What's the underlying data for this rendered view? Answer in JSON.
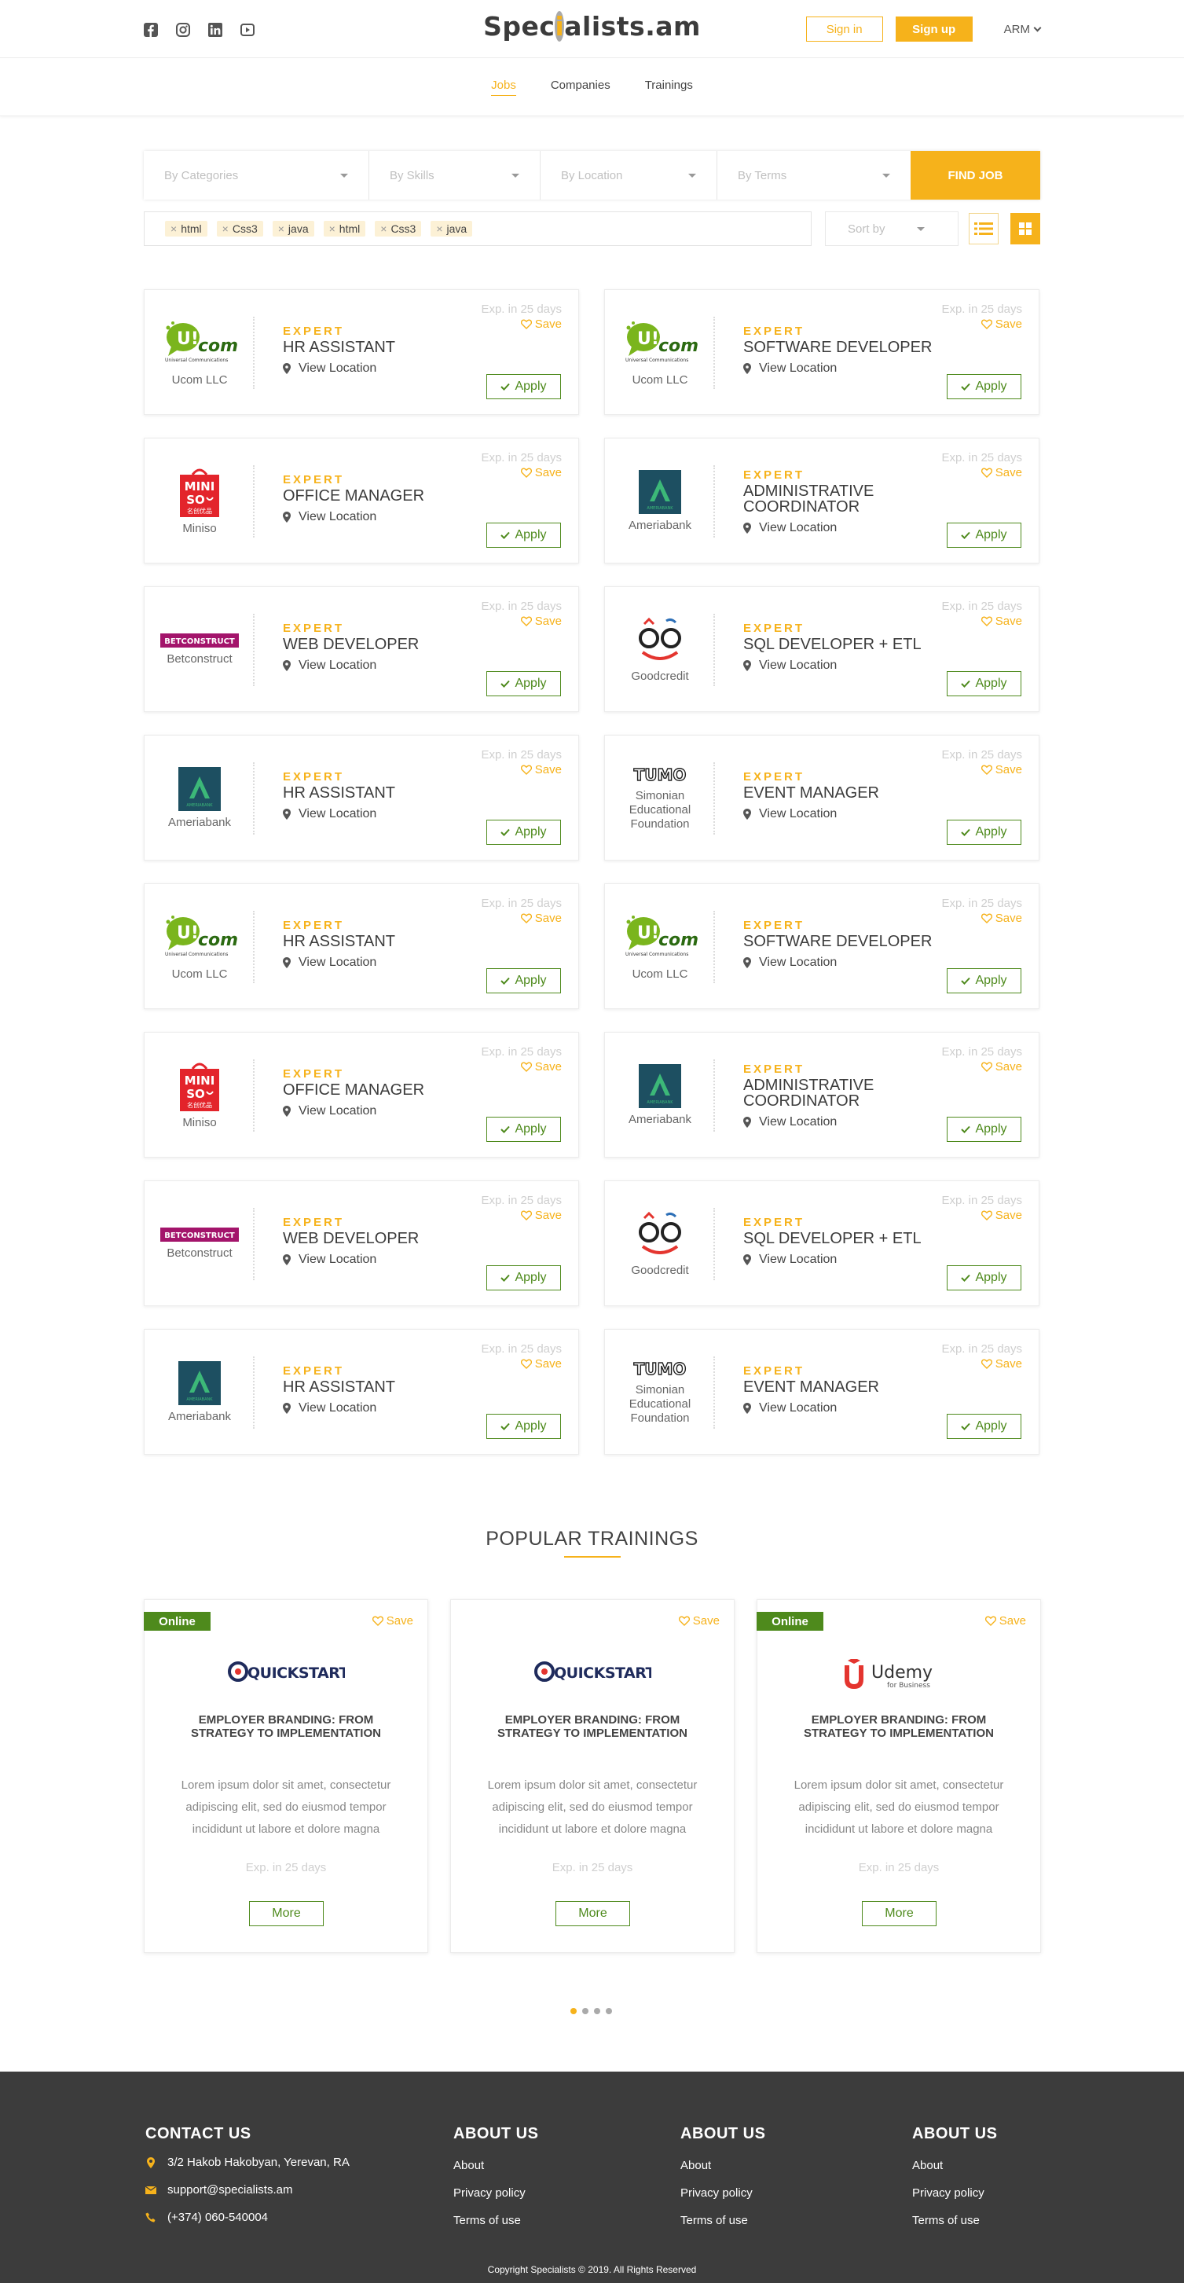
{
  "header": {
    "logo": "Specìalists.am",
    "logo_parts": {
      "before": "Spec",
      "dot": "i",
      "after": "alists.am"
    },
    "sign_in": "Sign in",
    "sign_up": "Sign up",
    "language": "ARM",
    "socials": [
      "facebook-icon",
      "instagram-icon",
      "linkedin-icon",
      "youtube-icon"
    ]
  },
  "nav": {
    "items": [
      {
        "label": "Jobs",
        "active": true
      },
      {
        "label": "Companies",
        "active": false
      },
      {
        "label": "Trainings",
        "active": false
      }
    ]
  },
  "search": {
    "categories": "By Categories",
    "skills": "By Skills",
    "location": "By Location",
    "terms": "By Terms",
    "find_button": "FIND JOB",
    "tags": [
      "html",
      "Css3",
      "java",
      "html",
      "Css3",
      "java"
    ],
    "sort_by": "Sort by"
  },
  "jobs": [
    {
      "company": "Ucom LLC",
      "logo": "ucom",
      "level": "EXPERT",
      "title": "HR ASSISTANT",
      "location": "View Location",
      "expires": "Exp. in 25 days",
      "save": "Save",
      "apply": "Apply"
    },
    {
      "company": "Ucom LLC",
      "logo": "ucom",
      "level": "EXPERT",
      "title": "SOFTWARE DEVELOPER",
      "location": "View Location",
      "expires": "Exp. in 25 days",
      "save": "Save",
      "apply": "Apply"
    },
    {
      "company": "Miniso",
      "logo": "miniso",
      "level": "EXPERT",
      "title": "OFFICE MANAGER",
      "location": "View Location",
      "expires": "Exp. in 25 days",
      "save": "Save",
      "apply": "Apply"
    },
    {
      "company": "Ameriabank",
      "logo": "ameria",
      "level": "EXPERT",
      "title": "ADMINISTRATIVE COORDINATOR",
      "location": "View Location",
      "expires": "Exp. in 25 days",
      "save": "Save",
      "apply": "Apply"
    },
    {
      "company": "Betconstruct",
      "logo": "betc",
      "level": "EXPERT",
      "title": "WEB DEVELOPER",
      "location": "View Location",
      "expires": "Exp. in 25 days",
      "save": "Save",
      "apply": "Apply"
    },
    {
      "company": "Goodcredit",
      "logo": "goodc",
      "level": "EXPERT",
      "title": "SQL DEVELOPER + ETL",
      "location": "View Location",
      "expires": "Exp. in 25 days",
      "save": "Save",
      "apply": "Apply"
    },
    {
      "company": "Ameriabank",
      "logo": "ameria",
      "level": "EXPERT",
      "title": "HR ASSISTANT",
      "location": "View Location",
      "expires": "Exp. in 25 days",
      "save": "Save",
      "apply": "Apply"
    },
    {
      "company": "Simonian Educational Foundation",
      "logo": "tumo",
      "level": "EXPERT",
      "title": "EVENT MANAGER",
      "location": "View Location",
      "expires": "Exp. in 25 days",
      "save": "Save",
      "apply": "Apply"
    },
    {
      "company": "Ucom LLC",
      "logo": "ucom",
      "level": "EXPERT",
      "title": "HR ASSISTANT",
      "location": "View Location",
      "expires": "Exp. in 25 days",
      "save": "Save",
      "apply": "Apply"
    },
    {
      "company": "Ucom LLC",
      "logo": "ucom",
      "level": "EXPERT",
      "title": "SOFTWARE DEVELOPER",
      "location": "View Location",
      "expires": "Exp. in 25 days",
      "save": "Save",
      "apply": "Apply"
    },
    {
      "company": "Miniso",
      "logo": "miniso",
      "level": "EXPERT",
      "title": "OFFICE MANAGER",
      "location": "View Location",
      "expires": "Exp. in 25 days",
      "save": "Save",
      "apply": "Apply"
    },
    {
      "company": "Ameriabank",
      "logo": "ameria",
      "level": "EXPERT",
      "title": "ADMINISTRATIVE COORDINATOR",
      "location": "View Location",
      "expires": "Exp. in 25 days",
      "save": "Save",
      "apply": "Apply"
    },
    {
      "company": "Betconstruct",
      "logo": "betc",
      "level": "EXPERT",
      "title": "WEB DEVELOPER",
      "location": "View Location",
      "expires": "Exp. in 25 days",
      "save": "Save",
      "apply": "Apply"
    },
    {
      "company": "Goodcredit",
      "logo": "goodc",
      "level": "EXPERT",
      "title": "SQL DEVELOPER + ETL",
      "location": "View Location",
      "expires": "Exp. in 25 days",
      "save": "Save",
      "apply": "Apply"
    },
    {
      "company": "Ameriabank",
      "logo": "ameria",
      "level": "EXPERT",
      "title": "HR ASSISTANT",
      "location": "View Location",
      "expires": "Exp. in 25 days",
      "save": "Save",
      "apply": "Apply"
    },
    {
      "company": "Simonian Educational Foundation",
      "logo": "tumo",
      "level": "EXPERT",
      "title": "EVENT MANAGER",
      "location": "View Location",
      "expires": "Exp. in 25 days",
      "save": "Save",
      "apply": "Apply"
    }
  ],
  "logo_texts": {
    "ucom_main": "U!com",
    "ucom_sub": "Universal Communications",
    "miniso_top": "MINI",
    "miniso_mid": "SO",
    "miniso_cn": "名创优品",
    "ameria_sub": "AMERIABANK",
    "betc": "BETCONSTRUCT",
    "tumo": "TUMO",
    "quickstart": "QUICKSTART",
    "udemy": "Udemy",
    "udemy_sub": "for Business"
  },
  "trainings": {
    "heading": "POPULAR TRAININGS",
    "items": [
      {
        "badge": "Online",
        "logo": "quickstart",
        "save": "Save",
        "title": "EMPLOYER BRANDING: FROM STRATEGY TO IMPLEMENTATION",
        "desc": "Lorem ipsum dolor sit amet, consectetur adipiscing elit, sed do eiusmod tempor incididunt ut labore et dolore magna",
        "expires": "Exp. in 25 days",
        "more": "More"
      },
      {
        "badge": "",
        "logo": "quickstart",
        "save": "Save",
        "title": "EMPLOYER BRANDING: FROM STRATEGY TO IMPLEMENTATION",
        "desc": "Lorem ipsum dolor sit amet, consectetur adipiscing elit, sed do eiusmod tempor incididunt ut labore et dolore magna",
        "expires": "Exp. in 25 days",
        "more": "More"
      },
      {
        "badge": "Online",
        "logo": "udemy",
        "save": "Save",
        "title": "EMPLOYER BRANDING: FROM STRATEGY TO IMPLEMENTATION",
        "desc": "Lorem ipsum dolor sit amet, consectetur adipiscing elit, sed do eiusmod tempor incididunt ut labore et dolore magna",
        "expires": "Exp. in 25 days",
        "more": "More"
      }
    ],
    "carousel_pages": 4,
    "carousel_active": 1
  },
  "footer": {
    "contact": {
      "heading": "CONTACT US",
      "address": "3/2 Hakob Hakobyan, Yerevan, RA",
      "email": "support@specialists.am",
      "phone": "(+374) 060-540004"
    },
    "about_columns": [
      {
        "heading": "ABOUT US",
        "links": [
          "About",
          "Privacy policy",
          "Terms of use"
        ]
      },
      {
        "heading": "ABOUT US",
        "links": [
          "About",
          "Privacy policy",
          "Terms of use"
        ]
      },
      {
        "heading": "ABOUT US",
        "links": [
          "About",
          "Privacy policy",
          "Terms of use"
        ]
      }
    ],
    "copyright": "Copyright Specialists © 2019. All Rights Reserved"
  },
  "colors": {
    "accent": "#f6b21b",
    "green": "#4e8a1c",
    "footer_bg": "#3c3c3c"
  }
}
